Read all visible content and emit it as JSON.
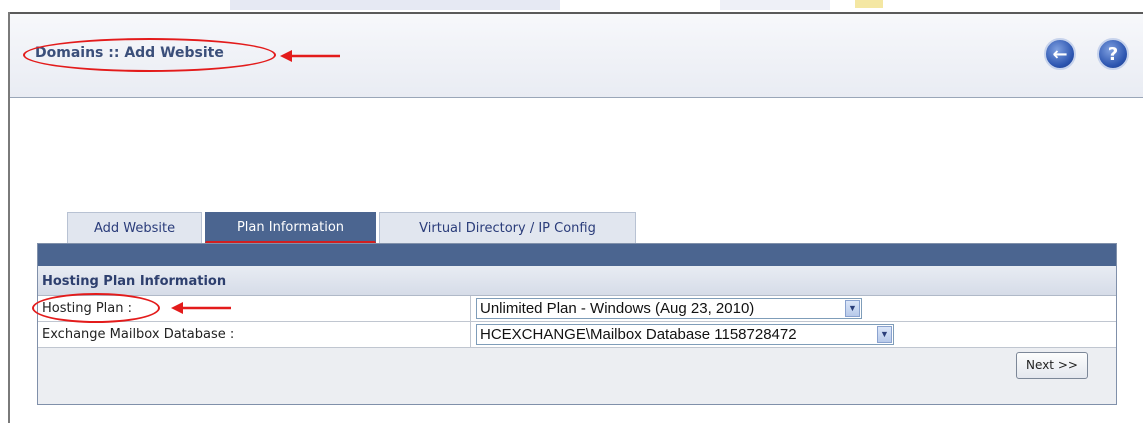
{
  "page": {
    "title": "Domains :: Add Website"
  },
  "header": {
    "back_icon": "back-arrow-icon",
    "help_icon": "help-question-icon",
    "back_glyph": "←",
    "help_glyph": "?"
  },
  "tabs": [
    {
      "label": "Add Website",
      "active": false
    },
    {
      "label": "Plan Information",
      "active": true
    },
    {
      "label": "Virtual Directory / IP Config",
      "active": false
    }
  ],
  "section": {
    "title": "Hosting Plan Information"
  },
  "fields": [
    {
      "label": "Hosting Plan :",
      "value": "Unlimited Plan - Windows (Aug 23, 2010)"
    },
    {
      "label": "Exchange Mailbox Database :",
      "value": "HCEXCHANGE\\Mailbox Database 1158728472"
    }
  ],
  "buttons": {
    "next": "Next >>"
  },
  "colors": {
    "accent": "#4b6590",
    "annotation": "#e31b1b",
    "title_text": "#3b4f7a"
  }
}
